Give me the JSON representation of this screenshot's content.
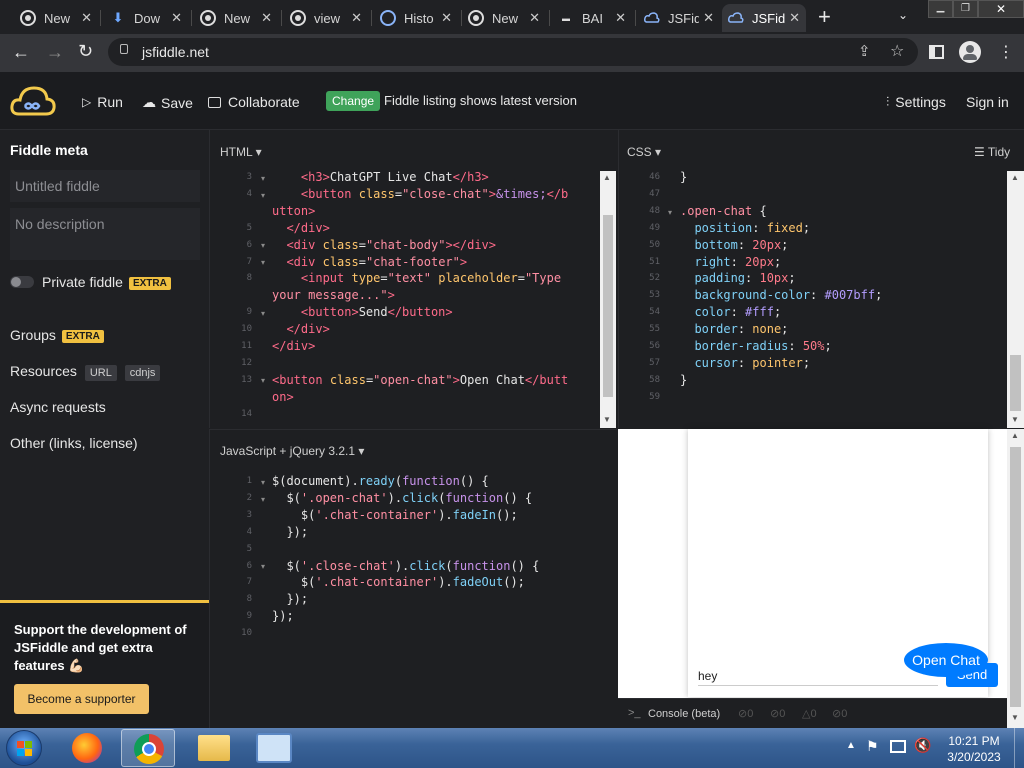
{
  "browser": {
    "tabs": [
      {
        "label": "New",
        "icon": "chrome-icon"
      },
      {
        "label": "Dow",
        "icon": "download-icon"
      },
      {
        "label": "New",
        "icon": "chrome-icon"
      },
      {
        "label": "view",
        "icon": "chrome-icon"
      },
      {
        "label": "Histo",
        "icon": "history-icon"
      },
      {
        "label": "New",
        "icon": "chrome-icon"
      },
      {
        "label": "BAI",
        "icon": "bai-icon"
      },
      {
        "label": "JSFid",
        "icon": "jsfiddle-icon"
      },
      {
        "label": "JSFid",
        "icon": "jsfiddle-icon",
        "active": true
      }
    ],
    "url": "jsfiddle.net"
  },
  "header": {
    "run": "Run",
    "save": "Save",
    "collaborate": "Collaborate",
    "change_badge": "Change",
    "listing_text": "Fiddle listing shows latest version",
    "settings": "Settings",
    "sign_in": "Sign in"
  },
  "sidebar": {
    "title": "Fiddle meta",
    "title_placeholder": "Untitled fiddle",
    "desc_placeholder": "No description",
    "private_label": "Private fiddle",
    "extra": "EXTRA",
    "groups": "Groups",
    "resources": "Resources",
    "url_badge": "URL",
    "cdnjs_badge": "cdnjs",
    "async": "Async requests",
    "other": "Other (links, license)",
    "support_text": "Support the development of JSFiddle and get extra features 💪🏻",
    "supporter_button": "Become a supporter"
  },
  "html_panel": {
    "label": "HTML",
    "line_numbers": [
      "3",
      "4",
      "",
      "5",
      "6",
      "7",
      "8",
      "",
      "9",
      "10",
      "11",
      "12",
      "13",
      "",
      "14"
    ]
  },
  "css_panel": {
    "label": "CSS",
    "tidy": "Tidy",
    "line_numbers": [
      "46",
      "47",
      "48",
      "49",
      "50",
      "51",
      "52",
      "53",
      "54",
      "55",
      "56",
      "57",
      "58",
      "59"
    ]
  },
  "js_panel": {
    "label": "JavaScript + jQuery 3.2.1",
    "line_numbers": [
      "1",
      "2",
      "3",
      "4",
      "5",
      "6",
      "7",
      "8",
      "9",
      "10"
    ]
  },
  "result": {
    "input_value": "hey",
    "send_button": "Send",
    "open_chat_button": "Open Chat",
    "console_label": "Console (beta)",
    "console_counts": [
      "0",
      "0",
      "0",
      "0"
    ]
  },
  "taskbar": {
    "time": "10:21 PM",
    "date": "3/20/2023"
  },
  "colors": {
    "accent_blue": "#007bff",
    "change_green": "#3fa35a",
    "extra_yellow": "#f0c040"
  }
}
